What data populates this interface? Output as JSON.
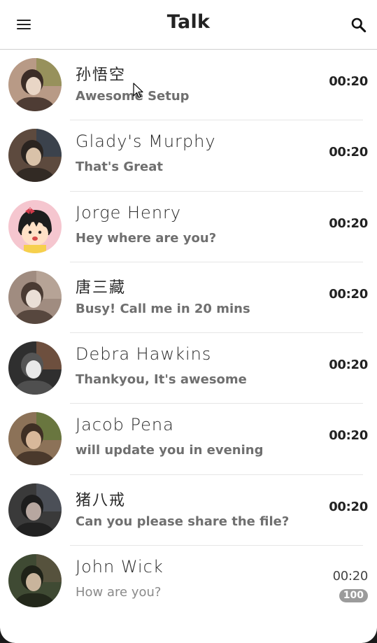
{
  "app": {
    "title": "Talk"
  },
  "icons": {
    "menu": "menu-icon",
    "search": "search-icon"
  },
  "chats": [
    {
      "name": "孙悟空",
      "message": "Awesome Setup",
      "time": "00:20",
      "unread": "",
      "avatar": "avatar-photo",
      "cjk": true,
      "bold": true
    },
    {
      "name": "Glady's Murphy",
      "message": "That's Great",
      "time": "00:20",
      "unread": "",
      "avatar": "avatar-photo",
      "cjk": false,
      "bold": true
    },
    {
      "name": "Jorge Henry",
      "message": "Hey where are you?",
      "time": "00:20",
      "unread": "",
      "avatar": "avatar-cartoon",
      "cjk": false,
      "bold": true
    },
    {
      "name": "唐三藏",
      "message": "Busy! Call me in 20 mins",
      "time": "00:20",
      "unread": "",
      "avatar": "avatar-photo",
      "cjk": true,
      "bold": true
    },
    {
      "name": "Debra Hawkins",
      "message": "Thankyou, It's awesome",
      "time": "00:20",
      "unread": "",
      "avatar": "avatar-photo",
      "cjk": false,
      "bold": true
    },
    {
      "name": "Jacob Pena",
      "message": "will update you in evening",
      "time": "00:20",
      "unread": "",
      "avatar": "avatar-photo",
      "cjk": false,
      "bold": true
    },
    {
      "name": "猪八戒",
      "message": "Can you please share the file?",
      "time": "00:20",
      "unread": "",
      "avatar": "avatar-photo",
      "cjk": true,
      "bold": true
    },
    {
      "name": "John Wick",
      "message": "How are you?",
      "time": "00:20",
      "unread": "100",
      "avatar": "avatar-photo",
      "cjk": false,
      "bold": false
    }
  ]
}
